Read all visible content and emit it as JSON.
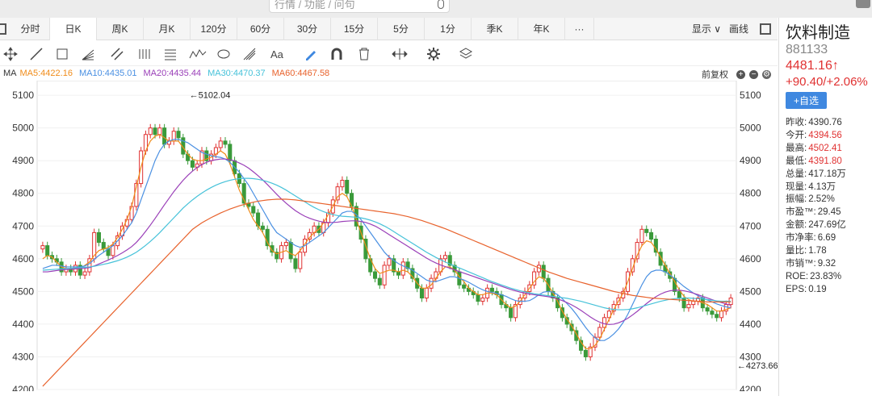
{
  "search": {
    "placeholder": "行情 / 功能 / 问句"
  },
  "tabs": [
    "分时",
    "日K",
    "周K",
    "月K",
    "120分",
    "60分",
    "30分",
    "15分",
    "5分",
    "1分",
    "季K",
    "年K",
    "···"
  ],
  "active_tab": 1,
  "toolbar_right": {
    "display": "显示 ∨",
    "draw": "画线"
  },
  "ma": {
    "label": "MA",
    "items": [
      {
        "text": "MA5:4422.16",
        "color": "#f08c1a"
      },
      {
        "text": "MA10:4435.01",
        "color": "#4a90e2"
      },
      {
        "text": "MA20:4435.44",
        "color": "#9a3fb8"
      },
      {
        "text": "MA30:4470.37",
        "color": "#46c2d9"
      },
      {
        "text": "MA60:4467.58",
        "color": "#e8622c"
      }
    ],
    "adjust": "前复权"
  },
  "stock": {
    "name": "饮料制造",
    "code": "881133",
    "price": "4481.16↑",
    "change": "+90.40/+2.06%",
    "add_button": "+自选"
  },
  "stats": [
    {
      "label": "昨收:",
      "value": "4390.76",
      "red": false
    },
    {
      "label": "今开:",
      "value": "4394.56",
      "red": true
    },
    {
      "label": "最高:",
      "value": "4502.41",
      "red": true
    },
    {
      "label": "最低:",
      "value": "4391.80",
      "red": true
    },
    {
      "label": "总量:",
      "value": "417.18万",
      "red": false
    },
    {
      "label": "现量:",
      "value": "4.13万",
      "red": false
    },
    {
      "label": "振幅:",
      "value": "2.52%",
      "red": false
    },
    {
      "label": "市盈™:",
      "value": "29.45",
      "red": false
    },
    {
      "label": "金额:",
      "value": "247.69亿",
      "red": false
    },
    {
      "label": "市净率:",
      "value": "6.69",
      "red": false
    },
    {
      "label": "量比:",
      "value": "1.78",
      "red": false
    },
    {
      "label": "市销™:",
      "value": "9.32",
      "red": false
    },
    {
      "label": "ROE:",
      "value": "23.83%",
      "red": false
    },
    {
      "label": "EPS:",
      "value": "0.19",
      "red": false
    }
  ],
  "chart_data": {
    "type": "candlestick",
    "ylim": [
      4200,
      5120
    ],
    "yticks": [
      4200,
      4300,
      4400,
      4500,
      4600,
      4700,
      4800,
      4900,
      5000,
      5100
    ],
    "annotations": [
      {
        "text": "←5102.04",
        "index": 31,
        "value": 5102.04
      },
      {
        "text": "←4273.66",
        "index": 148,
        "value": 4273.66
      }
    ],
    "close": [
      4640,
      4610,
      4600,
      4590,
      4560,
      4570,
      4560,
      4580,
      4550,
      4560,
      4600,
      4680,
      4650,
      4630,
      4610,
      4640,
      4670,
      4700,
      4720,
      4760,
      4830,
      4930,
      4980,
      5000,
      4980,
      5000,
      4950,
      4960,
      4990,
      4970,
      4920,
      4900,
      4880,
      4890,
      4930,
      4900,
      4920,
      4940,
      4960,
      4950,
      4900,
      4860,
      4830,
      4770,
      4760,
      4740,
      4700,
      4690,
      4640,
      4620,
      4600,
      4640,
      4650,
      4600,
      4570,
      4620,
      4660,
      4680,
      4700,
      4680,
      4710,
      4740,
      4780,
      4820,
      4840,
      4800,
      4760,
      4700,
      4660,
      4600,
      4560,
      4540,
      4520,
      4580,
      4600,
      4560,
      4550,
      4590,
      4570,
      4540,
      4510,
      4480,
      4510,
      4540,
      4560,
      4600,
      4610,
      4580,
      4560,
      4520,
      4510,
      4500,
      4490,
      4470,
      4480,
      4510,
      4500,
      4490,
      4460,
      4450,
      4420,
      4460,
      4480,
      4500,
      4520,
      4560,
      4580,
      4540,
      4500,
      4480,
      4450,
      4420,
      4400,
      4380,
      4350,
      4320,
      4300,
      4330,
      4360,
      4390,
      4420,
      4440,
      4460,
      4480,
      4500,
      4560,
      4600,
      4650,
      4690,
      4680,
      4660,
      4620,
      4580,
      4560,
      4540,
      4500,
      4480,
      4450,
      4460,
      4470,
      4480,
      4450,
      4440,
      4430,
      4420,
      4440,
      4460,
      4480
    ],
    "ma_series": [
      {
        "name": "MA5",
        "color": "#f08c1a",
        "values": [
          4600,
          4610,
          4605,
          4590,
          4575,
          4570,
          4568,
          4570,
          4570,
          4580,
          4590,
          4610,
          4625,
          4630,
          4635,
          4645,
          4665,
          4690,
          4720,
          4760,
          4820,
          4880,
          4930,
          4960,
          4975,
          4980,
          4970,
          4960,
          4960,
          4960,
          4940,
          4920,
          4905,
          4900,
          4900,
          4905,
          4910,
          4920,
          4930,
          4920,
          4890,
          4850,
          4810,
          4780,
          4750,
          4720,
          4700,
          4680,
          4650,
          4625,
          4615,
          4620,
          4625,
          4615,
          4610,
          4625,
          4645,
          4665,
          4680,
          4690,
          4710,
          4735,
          4760,
          4790,
          4800,
          4790,
          4760,
          4720,
          4680,
          4640,
          4600,
          4570,
          4555,
          4560,
          4565,
          4565,
          4560,
          4565,
          4560,
          4545,
          4525,
          4510,
          4510,
          4520,
          4540,
          4560,
          4575,
          4575,
          4565,
          4545,
          4530,
          4510,
          4500,
          4490,
          4490,
          4495,
          4495,
          4490,
          4475,
          4460,
          4450,
          4455,
          4470,
          4490,
          4510,
          4530,
          4545,
          4540,
          4520,
          4495,
          4470,
          4440,
          4415,
          4395,
          4370,
          4345,
          4325,
          4325,
          4335,
          4355,
          4385,
          4415,
          4445,
          4470,
          4495,
          4530,
          4570,
          4610,
          4640,
          4655,
          4650,
          4630,
          4605,
          4580,
          4555,
          4530,
          4505,
          4485,
          4475,
          4470,
          4470,
          4465,
          4460,
          4450,
          4440,
          4440,
          4445,
          4450
        ]
      },
      {
        "name": "MA10",
        "color": "#4a90e2",
        "values": [
          4570,
          4575,
          4580,
          4580,
          4578,
          4575,
          4575,
          4575,
          4575,
          4578,
          4585,
          4598,
          4610,
          4620,
          4630,
          4640,
          4655,
          4670,
          4690,
          4710,
          4740,
          4780,
          4820,
          4860,
          4900,
          4930,
          4950,
          4960,
          4965,
          4965,
          4960,
          4955,
          4945,
          4935,
          4925,
          4920,
          4915,
          4912,
          4910,
          4905,
          4895,
          4880,
          4865,
          4845,
          4825,
          4800,
          4775,
          4750,
          4725,
          4700,
          4680,
          4670,
          4660,
          4650,
          4640,
          4635,
          4640,
          4650,
          4660,
          4670,
          4680,
          4695,
          4710,
          4725,
          4740,
          4745,
          4745,
          4735,
          4720,
          4700,
          4680,
          4660,
          4640,
          4620,
          4605,
          4595,
          4585,
          4578,
          4572,
          4565,
          4555,
          4545,
          4535,
          4530,
          4530,
          4535,
          4540,
          4545,
          4545,
          4540,
          4535,
          4528,
          4520,
          4512,
          4505,
          4500,
          4497,
          4494,
          4490,
          4485,
          4478,
          4472,
          4470,
          4470,
          4472,
          4480,
          4490,
          4498,
          4500,
          4498,
          4490,
          4478,
          4463,
          4448,
          4430,
          4410,
          4390,
          4372,
          4358,
          4350,
          4350,
          4358,
          4370,
          4385,
          4405,
          4430,
          4460,
          4490,
          4520,
          4545,
          4560,
          4565,
          4565,
          4560,
          4550,
          4540,
          4527,
          4515,
          4505,
          4495,
          4487,
          4480,
          4474,
          4468,
          4462,
          4457,
          4453,
          4450
        ]
      },
      {
        "name": "MA20",
        "color": "#9a3fb8",
        "values": [
          4560,
          4560,
          4562,
          4564,
          4566,
          4567,
          4568,
          4569,
          4570,
          4571,
          4573,
          4578,
          4584,
          4590,
          4596,
          4603,
          4610,
          4618,
          4627,
          4637,
          4650,
          4666,
          4684,
          4703,
          4723,
          4744,
          4765,
          4785,
          4805,
          4823,
          4840,
          4855,
          4868,
          4879,
          4888,
          4895,
          4900,
          4903,
          4905,
          4905,
          4903,
          4899,
          4893,
          4886,
          4877,
          4866,
          4854,
          4841,
          4827,
          4812,
          4797,
          4783,
          4770,
          4758,
          4747,
          4738,
          4730,
          4724,
          4719,
          4715,
          4712,
          4711,
          4711,
          4712,
          4714,
          4715,
          4716,
          4716,
          4714,
          4711,
          4706,
          4700,
          4692,
          4683,
          4674,
          4665,
          4656,
          4647,
          4638,
          4629,
          4620,
          4611,
          4602,
          4594,
          4587,
          4581,
          4576,
          4571,
          4566,
          4561,
          4556,
          4551,
          4546,
          4541,
          4536,
          4531,
          4526,
          4521,
          4516,
          4511,
          4506,
          4502,
          4498,
          4495,
          4492,
          4490,
          4488,
          4486,
          4484,
          4481,
          4477,
          4472,
          4466,
          4459,
          4451,
          4442,
          4432,
          4422,
          4413,
          4406,
          4401,
          4399,
          4400,
          4404,
          4410,
          4418,
          4428,
          4439,
          4451,
          4463,
          4474,
          4484,
          4492,
          4498,
          4502,
          4504,
          4504,
          4502,
          4499,
          4495,
          4490,
          4485,
          4480,
          4475,
          4470,
          4466,
          4462,
          4458
        ]
      },
      {
        "name": "MA30",
        "color": "#46c2d9",
        "values": [
          4565,
          4566,
          4567,
          4568,
          4569,
          4570,
          4571,
          4572,
          4573,
          4574,
          4575,
          4577,
          4580,
          4583,
          4586,
          4590,
          4594,
          4599,
          4605,
          4612,
          4620,
          4630,
          4641,
          4653,
          4666,
          4680,
          4695,
          4710,
          4725,
          4740,
          4755,
          4768,
          4780,
          4791,
          4801,
          4810,
          4818,
          4825,
          4831,
          4836,
          4840,
          4843,
          4845,
          4846,
          4846,
          4845,
          4843,
          4840,
          4836,
          4831,
          4825,
          4818,
          4810,
          4801,
          4792,
          4783,
          4774,
          4765,
          4757,
          4750,
          4744,
          4739,
          4735,
          4732,
          4730,
          4729,
          4728,
          4727,
          4725,
          4722,
          4718,
          4713,
          4707,
          4700,
          4692,
          4683,
          4674,
          4665,
          4656,
          4647,
          4638,
          4629,
          4620,
          4612,
          4604,
          4597,
          4590,
          4584,
          4578,
          4572,
          4566,
          4560,
          4554,
          4548,
          4542,
          4536,
          4530,
          4525,
          4520,
          4515,
          4510,
          4506,
          4502,
          4499,
          4496,
          4493,
          4491,
          4489,
          4487,
          4485,
          4483,
          4481,
          4479,
          4476,
          4473,
          4470,
          4466,
          4462,
          4458,
          4454,
          4450,
          4447,
          4445,
          4444,
          4444,
          4445,
          4447,
          4450,
          4454,
          4458,
          4462,
          4466,
          4470,
          4473,
          4476,
          4478,
          4479,
          4480,
          4480,
          4479,
          4478,
          4477,
          4475,
          4473,
          4471,
          4470,
          4470,
          4470
        ]
      },
      {
        "name": "MA60",
        "color": "#e8622c",
        "values": [
          4210,
          4225,
          4240,
          4255,
          4270,
          4285,
          4300,
          4315,
          4330,
          4345,
          4360,
          4375,
          4390,
          4405,
          4420,
          4435,
          4450,
          4465,
          4480,
          4495,
          4510,
          4525,
          4540,
          4555,
          4570,
          4585,
          4600,
          4615,
          4630,
          4645,
          4660,
          4675,
          4690,
          4700,
          4710,
          4718,
          4726,
          4733,
          4740,
          4746,
          4752,
          4757,
          4762,
          4766,
          4770,
          4773,
          4776,
          4778,
          4780,
          4781,
          4782,
          4782,
          4782,
          4781,
          4780,
          4778,
          4776,
          4774,
          4772,
          4770,
          4768,
          4766,
          4764,
          4762,
          4760,
          4758,
          4756,
          4754,
          4752,
          4750,
          4748,
          4746,
          4744,
          4742,
          4740,
          4738,
          4735,
          4732,
          4729,
          4725,
          4721,
          4717,
          4712,
          4707,
          4702,
          4697,
          4692,
          4686,
          4680,
          4674,
          4668,
          4662,
          4656,
          4650,
          4644,
          4638,
          4632,
          4626,
          4620,
          4614,
          4608,
          4602,
          4596,
          4590,
          4584,
          4578,
          4572,
          4566,
          4560,
          4555,
          4550,
          4545,
          4540,
          4536,
          4532,
          4528,
          4524,
          4520,
          4516,
          4512,
          4508,
          4504,
          4500,
          4497,
          4494,
          4491,
          4488,
          4486,
          4484,
          4482,
          4480,
          4479,
          4478,
          4477,
          4476,
          4475,
          4474,
          4473,
          4472,
          4471,
          4470,
          4469,
          4468,
          4468,
          4468,
          4468,
          4468,
          4468
        ]
      }
    ]
  }
}
